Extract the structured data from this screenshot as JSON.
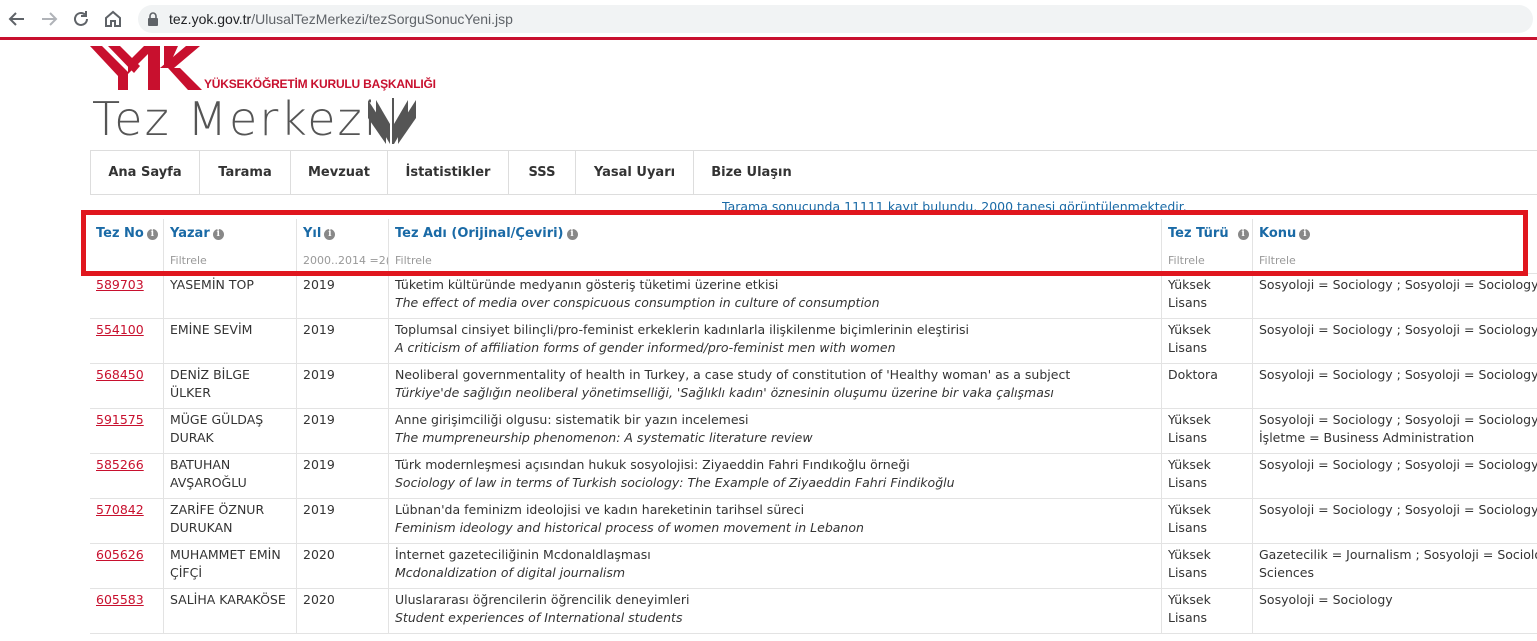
{
  "browser": {
    "url_host": "tez.yok.gov.tr",
    "url_path": "/UlusalTezMerkezi/tezSorguSonucYeni.jsp"
  },
  "header": {
    "org_name": "YÜKSEKÖĞRETİM KURULU BAŞKANLIĞI",
    "title": "Tez Merkezi"
  },
  "menu": [
    {
      "label": "Ana Sayfa"
    },
    {
      "label": "Tarama"
    },
    {
      "label": "Mevzuat"
    },
    {
      "label": "İstatistikler"
    },
    {
      "label": "SSS"
    },
    {
      "label": "Yasal Uyarı"
    },
    {
      "label": "Bize Ulaşın"
    }
  ],
  "result_info": "Tarama sonucunda 11111 kayıt bulundu. 2000 tanesi görüntülenmektedir.",
  "table": {
    "columns": [
      {
        "label": "Tez No",
        "info": "i"
      },
      {
        "label": "Yazar",
        "info": "i"
      },
      {
        "label": "Yıl",
        "info": "i"
      },
      {
        "label": "Tez Adı (Orijinal/Çeviri)",
        "info": "i"
      },
      {
        "label": "Tez Türü",
        "info": "i"
      },
      {
        "label": "Konu",
        "info": "i"
      }
    ],
    "filters": [
      {
        "placeholder": "",
        "value": ""
      },
      {
        "placeholder": "Filtrele",
        "value": ""
      },
      {
        "placeholder": "",
        "value": "2000..2014 =2("
      },
      {
        "placeholder": "Filtrele",
        "value": ""
      },
      {
        "placeholder": "Filtrele",
        "value": ""
      },
      {
        "placeholder": "Filtrele",
        "value": ""
      }
    ],
    "rows": [
      {
        "no": "589703",
        "author": [
          "YASEMİN TOP"
        ],
        "year": "2019",
        "title_tr": "Tüketim kültüründe medyanın gösteriş tüketimi üzerine etkisi",
        "title_en": "The effect of media over conspicuous consumption in culture of consumption",
        "type": [
          "Yüksek",
          "Lisans"
        ],
        "subject": [
          "Sosyoloji = Sociology ; Sosyoloji = Sociology"
        ]
      },
      {
        "no": "554100",
        "author": [
          "EMİNE SEVİM"
        ],
        "year": "2019",
        "title_tr": "Toplumsal cinsiyet bilinçli/pro-feminist erkeklerin kadınlarla ilişkilenme biçimlerinin eleştirisi",
        "title_en": "A criticism of affiliation forms of gender informed/pro-feminist men with women",
        "type": [
          "Yüksek",
          "Lisans"
        ],
        "subject": [
          "Sosyoloji = Sociology ; Sosyoloji = Sociology"
        ]
      },
      {
        "no": "568450",
        "author": [
          "DENİZ BİLGE",
          "ÜLKER"
        ],
        "year": "2019",
        "title_tr": "Neoliberal governmentality of health in Turkey, a case study of constitution of 'Healthy woman' as a subject",
        "title_en": "Türkiye'de sağlığın neoliberal yönetimselliği, 'Sağlıklı kadın' öznesinin oluşumu üzerine bir vaka çalışması",
        "type": [
          "Doktora"
        ],
        "subject": [
          "Sosyoloji = Sociology ; Sosyoloji = Sociology"
        ]
      },
      {
        "no": "591575",
        "author": [
          "MÜGE GÜLDAŞ",
          "DURAK"
        ],
        "year": "2019",
        "title_tr": "Anne girişimciliği olgusu: sistematik bir yazın incelemesi",
        "title_en": "The mumpreneurship phenomenon: A systematic literature review",
        "type": [
          "Yüksek",
          "Lisans"
        ],
        "subject": [
          "Sosyoloji = Sociology ; Sosyoloji = Sociology",
          "İşletme = Business Administration"
        ]
      },
      {
        "no": "585266",
        "author": [
          "BATUHAN",
          "AVŞAROĞLU"
        ],
        "year": "2019",
        "title_tr": "Türk modernleşmesi açısından hukuk sosyolojisi: Ziyaeddin Fahri Fındıkoğlu örneği",
        "title_en": "Sociology of law in terms of Turkish sociology: The Example of Ziyaeddin Fahri Findikoğlu",
        "type": [
          "Yüksek",
          "Lisans"
        ],
        "subject": [
          "Sosyoloji = Sociology ; Sosyoloji = Sociology"
        ]
      },
      {
        "no": "570842",
        "author": [
          "ZARİFE ÖZNUR",
          "DURUKAN"
        ],
        "year": "2019",
        "title_tr": "Lübnan'da feminizm ideolojisi ve kadın hareketinin tarihsel süreci",
        "title_en": "Feminism ideology and historical process of women movement in Lebanon",
        "type": [
          "Yüksek",
          "Lisans"
        ],
        "subject": [
          "Sosyoloji = Sociology ; Sosyoloji = Sociology"
        ]
      },
      {
        "no": "605626",
        "author": [
          "MUHAMMET EMİN",
          "ÇİFÇİ"
        ],
        "year": "2020",
        "title_tr": "İnternet gazeteciliğinin Mcdonaldlaşması",
        "title_en": "Mcdonaldization of digital journalism",
        "type": [
          "Yüksek",
          "Lisans"
        ],
        "subject": [
          "Gazetecilik = Journalism ; Sosyoloji = Sociology",
          "Sciences"
        ]
      },
      {
        "no": "605583",
        "author": [
          "SALİHA KARAKÖSE"
        ],
        "year": "2020",
        "title_tr": "Uluslararası öğrencilerin öğrencilik deneyimleri",
        "title_en": "Student experiences of International students",
        "type": [
          "Yüksek",
          "Lisans"
        ],
        "subject": [
          "Sosyoloji = Sociology"
        ]
      }
    ]
  }
}
